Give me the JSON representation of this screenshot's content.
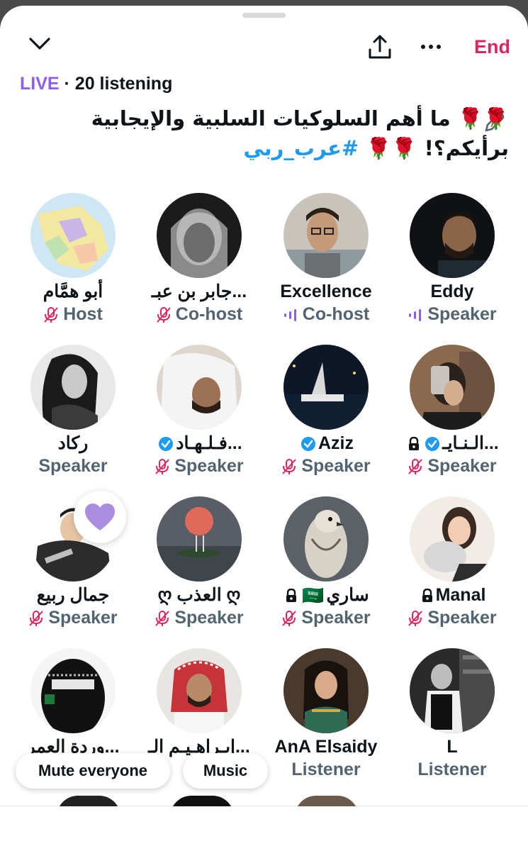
{
  "header": {
    "end_label": "End"
  },
  "status": {
    "live": "LIVE",
    "separator": " · ",
    "listening": "20 listening"
  },
  "title": {
    "line1": "🌹🌹 ما أهم السلوكيات السلبية والإيجابية",
    "line2_text": "برأيكم؟! 🌹🌹 ",
    "hashtag": "#عرب_ربي"
  },
  "participants": [
    {
      "name": "أبو همَّام",
      "role": "Host",
      "mic": "muted",
      "avatar": "map"
    },
    {
      "name": "جابر بن عبـ...",
      "role": "Co-host",
      "mic": "muted",
      "avatar": "bw-man"
    },
    {
      "name": "Excellence",
      "role": "Co-host",
      "mic": "speaking",
      "avatar": "man-glasses"
    },
    {
      "name": "Eddy",
      "role": "Speaker",
      "mic": "speaking",
      "avatar": "man-dark"
    },
    {
      "name": "ركاد",
      "role": "Speaker",
      "mic": "none",
      "avatar": "woman-bw"
    },
    {
      "name": "فـلـهـاد...",
      "role": "Speaker",
      "mic": "muted",
      "avatar": "man-ghutra",
      "verified": true
    },
    {
      "name": "Aziz",
      "role": "Speaker",
      "mic": "muted",
      "avatar": "boat-night",
      "verified": true
    },
    {
      "name": "الـنـايـ...",
      "role": "Speaker",
      "mic": "muted",
      "avatar": "woman-phone",
      "verified": true,
      "locked": true
    },
    {
      "name": "جمال ربيع",
      "role": "Speaker",
      "mic": "muted",
      "avatar": "cartoon"
    },
    {
      "name": "ღ العذب ღ",
      "role": "Speaker",
      "mic": "muted",
      "avatar": "moon-birds"
    },
    {
      "name": "ساري",
      "role": "Speaker",
      "mic": "muted",
      "avatar": "falcon",
      "locked": true,
      "flag": "🇸🇦"
    },
    {
      "name": "Manal",
      "role": "Speaker",
      "mic": "muted",
      "avatar": "woman-cat",
      "locked": true
    },
    {
      "name": "وردة العمر...",
      "role": "",
      "mic": "none",
      "avatar": "niqab"
    },
    {
      "name": "إبـراهـيـم الـ...",
      "role": "Lis",
      "mic": "none",
      "avatar": "man-shemagh"
    },
    {
      "name": "AnA Elsaidy",
      "role": "Listener",
      "mic": "none",
      "avatar": "woman-cleo"
    },
    {
      "name": "L",
      "role": "Listener",
      "mic": "none",
      "avatar": "bw-library"
    }
  ],
  "actions": {
    "mute_everyone": "Mute everyone",
    "music": "Music"
  },
  "colors": {
    "accent_purple": "#8c5df0",
    "end_red": "#e0245e",
    "hashtag_blue": "#1d9bf0",
    "muted_pink": "#e0245e",
    "role_gray": "#536471",
    "heart": "#a98ee0"
  }
}
